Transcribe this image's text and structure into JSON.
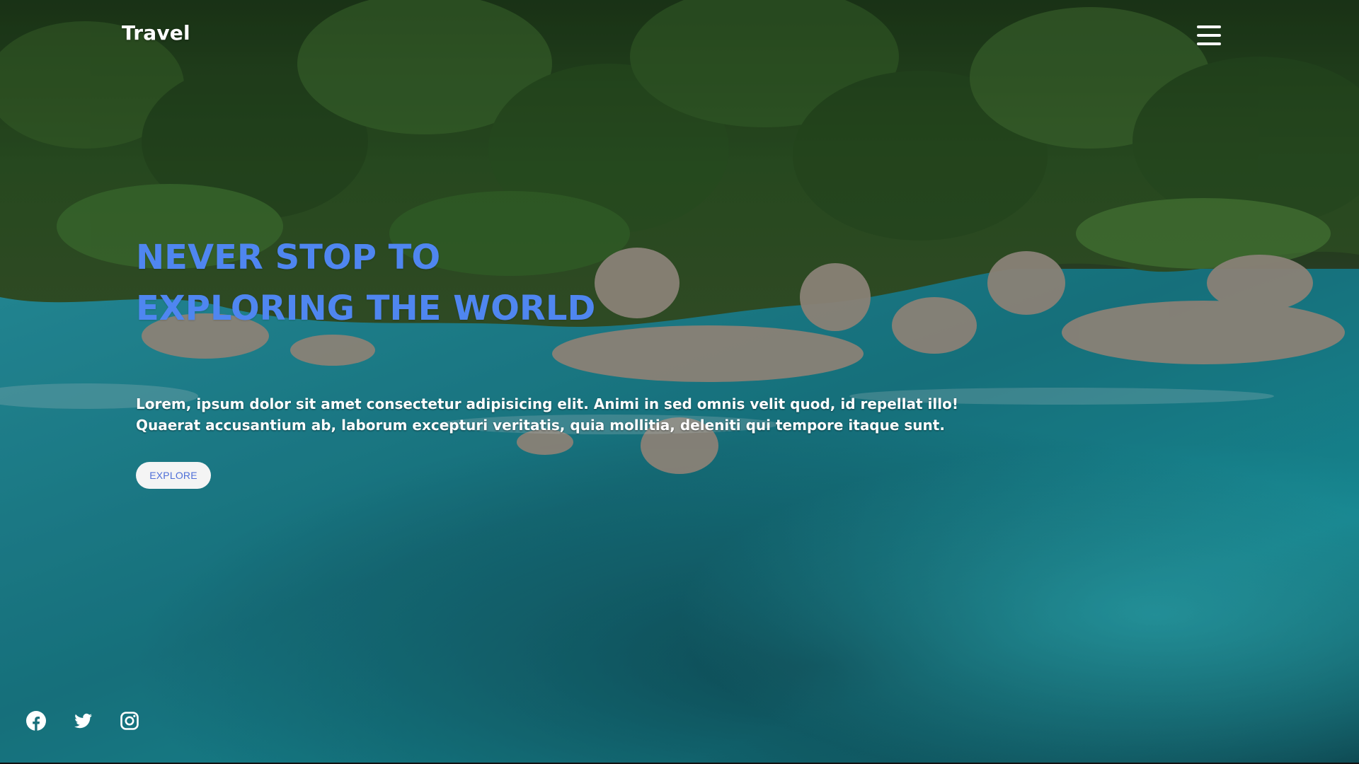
{
  "header": {
    "brand": "Travel",
    "menu_icon": "hamburger-menu-icon"
  },
  "hero": {
    "title_line1": "NEVER STOP TO",
    "title_line2": "EXPLORING THE WORLD",
    "title_color": "#4f86f0",
    "description_line1": "Lorem, ipsum dolor sit amet consectetur adipisicing elit. Animi in sed omnis velit quod, id repellat illo!",
    "description_line2": "Quaerat accusantium ab, laborum excepturi veritatis, quia mollitia, deleniti qui tempore itaque sunt.",
    "cta_label": "EXPLORE"
  },
  "socials": [
    {
      "icon": "facebook-icon"
    },
    {
      "icon": "twitter-icon"
    },
    {
      "icon": "instagram-icon"
    }
  ],
  "background": {
    "description_colors": {
      "jungle": "#2d5a26",
      "rocks": "#a49a8c",
      "water": "#1a8a96"
    }
  }
}
